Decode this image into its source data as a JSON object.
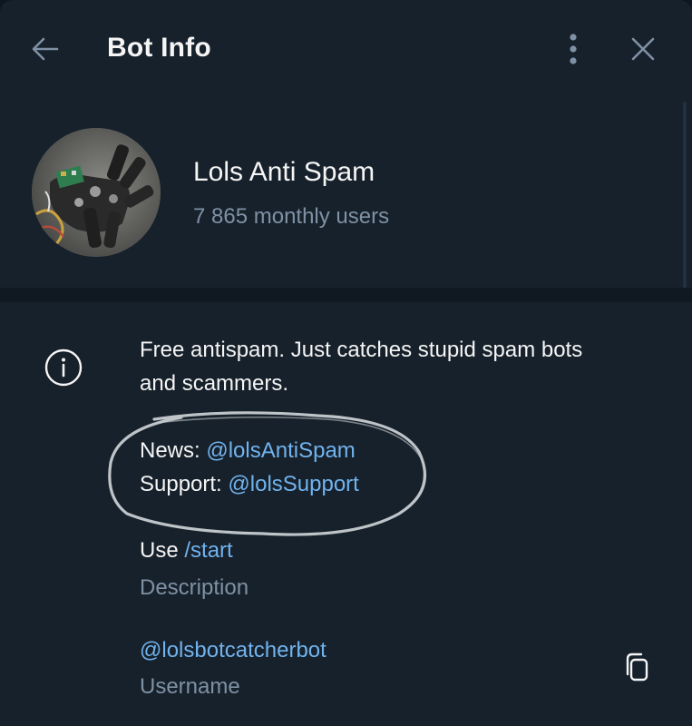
{
  "header": {
    "title": "Bot Info",
    "back_icon": "arrow-left-icon",
    "more_icon": "more-vertical-icon",
    "close_icon": "close-icon"
  },
  "profile": {
    "name": "Lols Anti Spam",
    "subtitle": "7 865 monthly users"
  },
  "info": {
    "icon": "info-icon",
    "description_line1": "Free antispam. Just catches stupid spam bots",
    "description_line2": "and scammers.",
    "news_label": "News: ",
    "news_link": "@lolsAntiSpam",
    "support_label": "Support: ",
    "support_link": "@lolsSupport",
    "use_label": "Use ",
    "use_command": "/start",
    "description_caption": "Description"
  },
  "username": {
    "value": "@lolsbotcatcherbot",
    "caption": "Username",
    "copy_icon": "copy-icon"
  },
  "colors": {
    "background": "#17212b",
    "link": "#71b3ee",
    "muted": "#7f91a4",
    "text": "#f5f5f5"
  }
}
